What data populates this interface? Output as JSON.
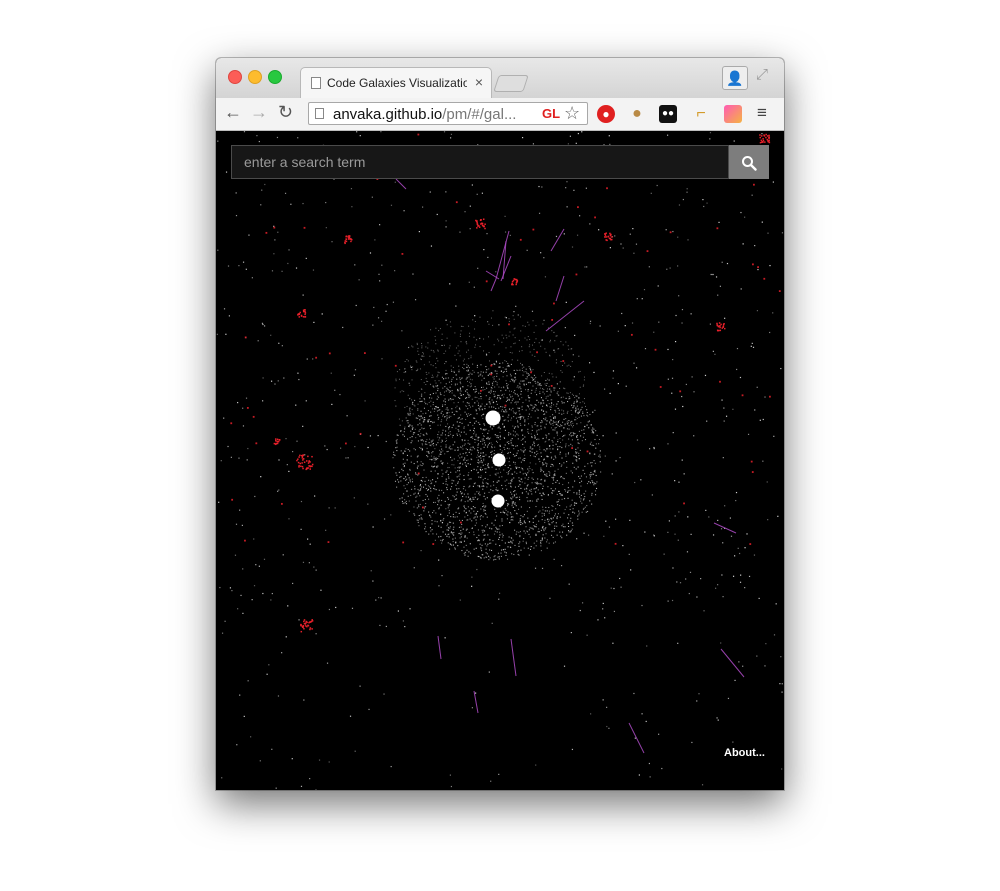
{
  "browser": {
    "tab_title": "Code Galaxies Visualization",
    "tab_close": "×",
    "url_host": "anvaka.github.io",
    "url_path": "/pm/#/gal...",
    "extension_badge": "GL"
  },
  "page": {
    "search_placeholder": "enter a search term",
    "about_link": "About..."
  },
  "icons": {
    "back": "←",
    "forward": "→",
    "reload": "↻",
    "star": "☆",
    "menu": "≡",
    "profile": "👤",
    "fullscreen": "⤢"
  },
  "colors": {
    "background": "#000000",
    "stars": "#d8d8d8",
    "red_clusters": "#e8202a",
    "edges": "#b04cc8",
    "search_button": "#7d7d7d"
  }
}
